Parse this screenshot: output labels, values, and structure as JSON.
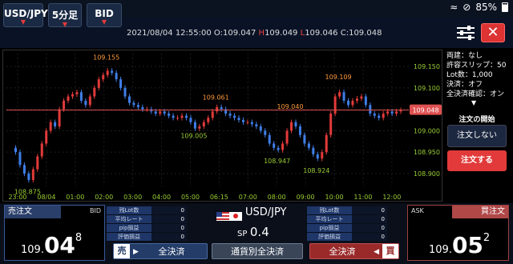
{
  "status": {
    "battery": "85%"
  },
  "toolbar": {
    "pair": "USD/JPY",
    "timeframe": "5分足",
    "price_type": "BID",
    "ohlc_time": "2021/08/04 12:55:00",
    "open": "O:109.047",
    "high_label": "H",
    "high": "109.049",
    "low_label": "L",
    "low": "109.046",
    "close": "C:109.048"
  },
  "chart_data": {
    "type": "candlestick",
    "x_labels": [
      "23:00",
      "08/04",
      "01:00",
      "02:00",
      "03:00",
      "04:00",
      "05:00",
      "06:15",
      "07:00",
      "08:00",
      "09:00",
      "10:00",
      "11:00",
      "12:00"
    ],
    "y_labels": [
      "109.150",
      "109.100",
      "109.050",
      "109.000",
      "108.950",
      "108.900"
    ],
    "ylim": [
      108.87,
      109.18
    ],
    "current_price": "109.048",
    "annotations": [
      {
        "label": "109.155",
        "value": 109.155,
        "kind": "high"
      },
      {
        "label": "108.875",
        "value": 108.875,
        "kind": "low"
      },
      {
        "label": "109.061",
        "value": 109.061,
        "kind": "high"
      },
      {
        "label": "109.005",
        "value": 109.005,
        "kind": "low"
      },
      {
        "label": "108.947",
        "value": 108.947,
        "kind": "low"
      },
      {
        "label": "109.040",
        "value": 109.04,
        "kind": "high"
      },
      {
        "label": "108.924",
        "value": 108.924,
        "kind": "low"
      },
      {
        "label": "109.109",
        "value": 109.109,
        "kind": "high"
      }
    ],
    "close_series": [
      108.95,
      108.92,
      108.9,
      108.885,
      108.91,
      108.94,
      108.97,
      109.0,
      109.02,
      109.01,
      109.05,
      109.07,
      109.08,
      109.085,
      109.09,
      109.07,
      109.06,
      109.08,
      109.1,
      109.12,
      109.13,
      109.14,
      109.135,
      109.12,
      109.1,
      109.08,
      109.065,
      109.06,
      109.055,
      109.05,
      109.05,
      109.045,
      109.04,
      109.045,
      109.04,
      109.035,
      109.03,
      109.03,
      109.035,
      109.03,
      109.02,
      109.005,
      109.01,
      109.02,
      109.03,
      109.045,
      109.055,
      109.05,
      109.04,
      109.035,
      109.03,
      109.025,
      109.02,
      109.02,
      109.015,
      109.01,
      109.0,
      108.99,
      108.97,
      108.96,
      108.955,
      108.97,
      109.0,
      109.02,
      109.01,
      108.99,
      108.97,
      108.96,
      108.945,
      108.935,
      108.95,
      108.99,
      109.04,
      109.08,
      109.09,
      109.07,
      109.06,
      109.07,
      109.075,
      109.08,
      109.06,
      109.04,
      109.035,
      109.03,
      109.04,
      109.045,
      109.04,
      109.045,
      109.048
    ]
  },
  "panel": {
    "info_lines": [
      "両建：なし",
      "許容スリップ：50",
      "Lot数：1,000",
      "決済：オフ",
      "全決済確認：オン"
    ],
    "order_title": "注文の開始",
    "no_order": "注文しない",
    "do_order": "注文する"
  },
  "bid": {
    "header": "売注文",
    "tag": "BID",
    "price_small": "109.",
    "price_big": "04",
    "price_sup": "8"
  },
  "ask": {
    "header": "買注文",
    "tag": "ASK",
    "price_small": "109.",
    "price_big": "05",
    "price_sup": "2"
  },
  "left_table": [
    {
      "k": "残Lot数",
      "v": "0"
    },
    {
      "k": "平均レート",
      "v": "0"
    },
    {
      "k": "pip損益",
      "v": "0"
    },
    {
      "k": "評価損益",
      "v": "0"
    }
  ],
  "right_table": [
    {
      "k": "残Lot数",
      "v": "0"
    },
    {
      "k": "平均レート",
      "v": "0"
    },
    {
      "k": "pip損益",
      "v": "0"
    },
    {
      "k": "評価損益",
      "v": "0"
    }
  ],
  "center": {
    "pair": "USD/JPY",
    "sp_label": "SP",
    "sp_value": "0.4"
  },
  "buttons": {
    "sell_short": "売",
    "sell_close": "全決済",
    "pair_close": "通貨別全決済",
    "buy_close": "全決済",
    "buy_short": "買"
  },
  "colors": {
    "up": "#e23a3a",
    "down": "#3f7ee8",
    "line": "#e05050",
    "low_label": "#9acd32",
    "high_label": "#ff9a3c"
  }
}
